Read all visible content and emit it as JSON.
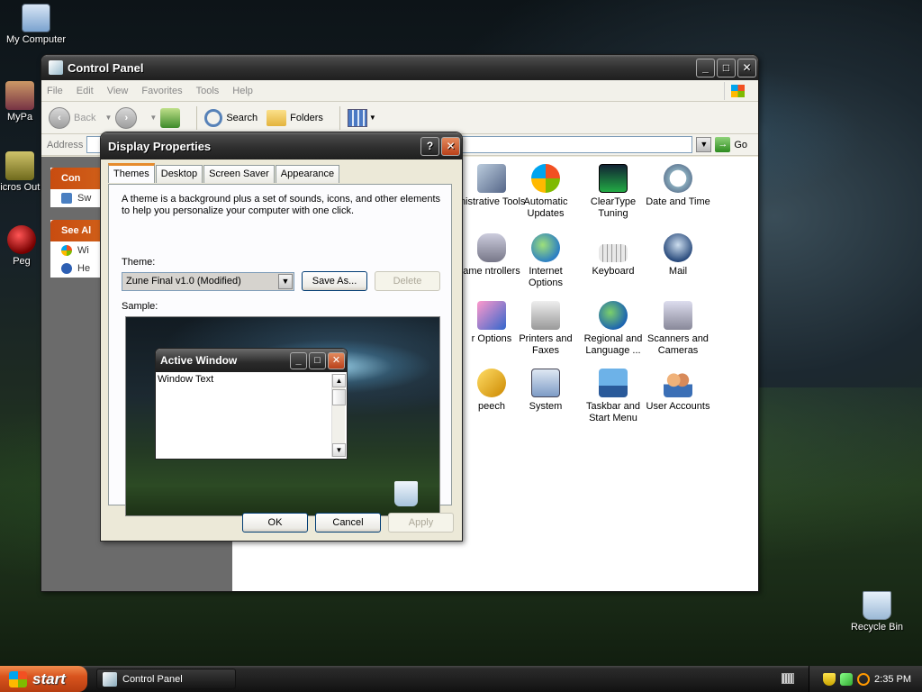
{
  "desktop": {
    "icons": [
      {
        "label": "My Computer",
        "icon": "computer-icon"
      },
      {
        "label": "MyPa",
        "icon": "mypa-icon"
      },
      {
        "label": "Micros Outlo",
        "icon": "outlook-icon"
      },
      {
        "label": "Peg",
        "icon": "peg-icon"
      },
      {
        "label": "Recycle Bin",
        "icon": "recycle-bin-icon"
      }
    ]
  },
  "control_panel": {
    "title": "Control Panel",
    "menu": [
      "File",
      "Edit",
      "View",
      "Favorites",
      "Tools",
      "Help"
    ],
    "toolbar": {
      "back": "Back",
      "search": "Search",
      "folders": "Folders"
    },
    "address_label": "Address",
    "go_label": "Go",
    "left_panel": {
      "box1": {
        "title": "Con",
        "items": [
          "Sw"
        ]
      },
      "box2": {
        "title": "See Al",
        "items": [
          "Wi",
          "He"
        ]
      }
    },
    "items": [
      {
        "label": "inistrative Tools",
        "icon": "admin-tools-icon"
      },
      {
        "label": "Automatic Updates",
        "icon": "windows-update-icon"
      },
      {
        "label": "ClearType Tuning",
        "icon": "cleartype-icon"
      },
      {
        "label": "Date and Time",
        "icon": "clock-icon"
      },
      {
        "label": "ame ntrollers",
        "icon": "game-controller-icon"
      },
      {
        "label": "Internet Options",
        "icon": "globe-icon"
      },
      {
        "label": "Keyboard",
        "icon": "keyboard-icon"
      },
      {
        "label": "Mail",
        "icon": "mail-icon"
      },
      {
        "label": "r Options",
        "icon": "options-icon"
      },
      {
        "label": "Printers and Faxes",
        "icon": "printer-icon"
      },
      {
        "label": "Regional and Language ...",
        "icon": "regional-globe-icon"
      },
      {
        "label": "Scanners and Cameras",
        "icon": "scanner-icon"
      },
      {
        "label": "peech",
        "icon": "speech-icon"
      },
      {
        "label": "System",
        "icon": "system-icon"
      },
      {
        "label": "Taskbar and Start Menu",
        "icon": "taskbar-icon"
      },
      {
        "label": "User Accounts",
        "icon": "users-icon"
      }
    ]
  },
  "display_properties": {
    "title": "Display Properties",
    "tabs": [
      "Themes",
      "Desktop",
      "Screen Saver",
      "Appearance"
    ],
    "description": "A theme is a background plus a set of sounds, icons, and other elements to help you personalize your computer with one click.",
    "theme_label": "Theme:",
    "theme_value": "Zune Final v1.0 (Modified)",
    "save_as": "Save As...",
    "delete": "Delete",
    "sample_label": "Sample:",
    "sample_window_title": "Active Window",
    "sample_window_text": "Window Text",
    "ok": "OK",
    "cancel": "Cancel",
    "apply": "Apply"
  },
  "taskbar": {
    "start": "start",
    "tasks": [
      "Control Panel"
    ],
    "clock": "2:35 PM"
  },
  "colors": {
    "start_orange": "#d9541e",
    "task_header_orange": "#c84c10",
    "title_dark": "#2f2f2f",
    "close_red": "#b9411a"
  }
}
